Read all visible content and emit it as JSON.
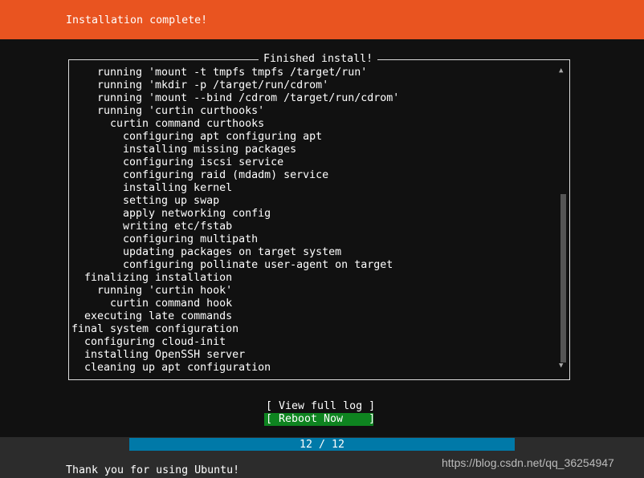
{
  "header": {
    "title": "Installation complete!"
  },
  "log_box": {
    "title": "Finished install!",
    "lines": [
      {
        "indent": 2,
        "text": "running 'mount -t tmpfs tmpfs /target/run'"
      },
      {
        "indent": 2,
        "text": "running 'mkdir -p /target/run/cdrom'"
      },
      {
        "indent": 2,
        "text": "running 'mount --bind /cdrom /target/run/cdrom'"
      },
      {
        "indent": 2,
        "text": "running 'curtin curthooks'"
      },
      {
        "indent": 3,
        "text": "curtin command curthooks"
      },
      {
        "indent": 4,
        "text": "configuring apt configuring apt"
      },
      {
        "indent": 4,
        "text": "installing missing packages"
      },
      {
        "indent": 4,
        "text": "configuring iscsi service"
      },
      {
        "indent": 4,
        "text": "configuring raid (mdadm) service"
      },
      {
        "indent": 4,
        "text": "installing kernel"
      },
      {
        "indent": 4,
        "text": "setting up swap"
      },
      {
        "indent": 4,
        "text": "apply networking config"
      },
      {
        "indent": 4,
        "text": "writing etc/fstab"
      },
      {
        "indent": 4,
        "text": "configuring multipath"
      },
      {
        "indent": 4,
        "text": "updating packages on target system"
      },
      {
        "indent": 4,
        "text": "configuring pollinate user-agent on target"
      },
      {
        "indent": 1,
        "text": "finalizing installation"
      },
      {
        "indent": 2,
        "text": "running 'curtin hook'"
      },
      {
        "indent": 3,
        "text": "curtin command hook"
      },
      {
        "indent": 1,
        "text": "executing late commands"
      },
      {
        "indent": 0,
        "text": "final system configuration"
      },
      {
        "indent": 1,
        "text": "configuring cloud-init"
      },
      {
        "indent": 1,
        "text": "installing OpenSSH server"
      },
      {
        "indent": 1,
        "text": "cleaning up apt configuration"
      }
    ],
    "scroll_up_icon": "▲",
    "scroll_down_icon": "▼"
  },
  "buttons": {
    "view_log": "[ View full log ]",
    "reboot": "[ Reboot Now    ]"
  },
  "colors": {
    "header": "#e95420",
    "reboot": "#0e8420",
    "progress": "#0079a8"
  },
  "footer": {
    "progress": "12 / 12",
    "progress_fraction": 1.0,
    "message": "Thank you for using Ubuntu!",
    "watermark": "https://blog.csdn.net/qq_36254947"
  }
}
